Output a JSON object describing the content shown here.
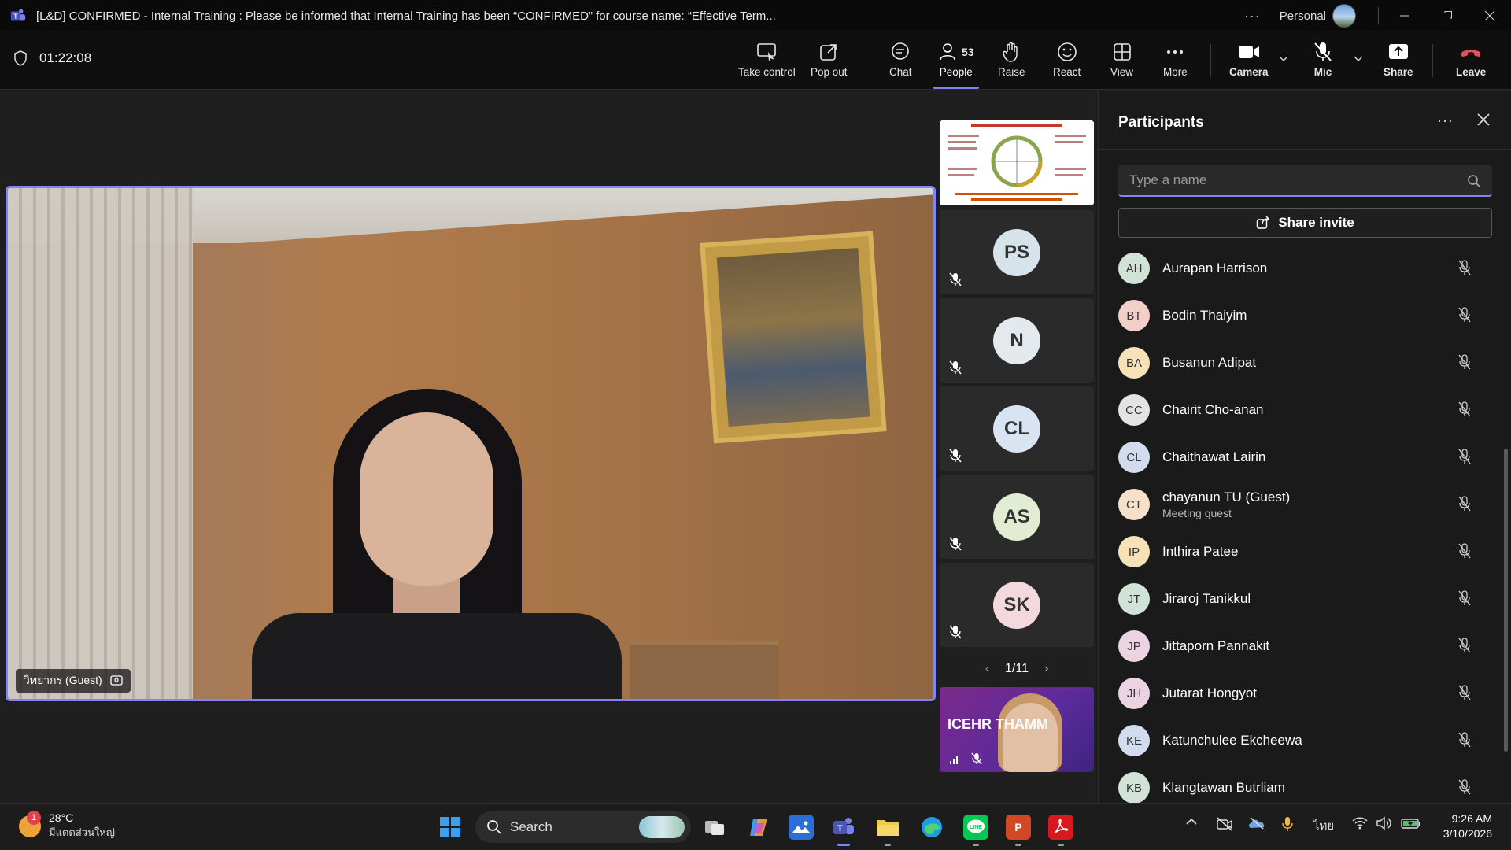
{
  "window": {
    "title": "[L&D] CONFIRMED - Internal Training : Please be informed that Internal Training has been “CONFIRMED” for course name: “Effective Term...",
    "more": "···",
    "profile": "Personal"
  },
  "meeting": {
    "timer": "01:22:08",
    "toolbar": {
      "take_control": "Take control",
      "pop_out": "Pop out",
      "chat": "Chat",
      "people": "People",
      "people_count": "53",
      "raise": "Raise",
      "react": "React",
      "view": "View",
      "more": "More",
      "camera": "Camera",
      "mic": "Mic",
      "share": "Share",
      "leave": "Leave"
    }
  },
  "stage": {
    "speaker_name": "วิทยากร (Guest)",
    "gallery": [
      {
        "initials": "PS"
      },
      {
        "initials": "N"
      },
      {
        "initials": "CL"
      },
      {
        "initials": "AS"
      },
      {
        "initials": "SK"
      }
    ],
    "pager": "1/11",
    "bottom_tile_text": "ICEHR THAMM"
  },
  "panel": {
    "title": "Participants",
    "search_placeholder": "Type a name",
    "share_invite": "Share invite",
    "participants": [
      {
        "initials": "AH",
        "name": "Aurapan Harrison",
        "sub": "",
        "color": "#d0e3d6"
      },
      {
        "initials": "BT",
        "name": "Bodin Thaiyim",
        "sub": "",
        "color": "#f2cfc8"
      },
      {
        "initials": "BA",
        "name": "Busanun Adipat",
        "sub": "",
        "color": "#f6e2b6"
      },
      {
        "initials": "CC",
        "name": "Chairit Cho-anan",
        "sub": "",
        "color": "#e3e3e3"
      },
      {
        "initials": "CL",
        "name": "Chaithawat Lairin",
        "sub": "",
        "color": "#d3dcef"
      },
      {
        "initials": "CT",
        "name": "chayanun TU (Guest)",
        "sub": "Meeting guest",
        "color": "#f7e0c9"
      },
      {
        "initials": "IP",
        "name": "Inthira Patee",
        "sub": "",
        "color": "#f6e2b6"
      },
      {
        "initials": "JT",
        "name": "Jiraroj Tanikkul",
        "sub": "",
        "color": "#d0e3d6"
      },
      {
        "initials": "JP",
        "name": "Jittaporn Pannakit",
        "sub": "",
        "color": "#ecd3e2"
      },
      {
        "initials": "JH",
        "name": "Jutarat Hongyot",
        "sub": "",
        "color": "#ecd3e2"
      },
      {
        "initials": "KE",
        "name": "Katunchulee Ekcheewa",
        "sub": "",
        "color": "#d3dcef"
      },
      {
        "initials": "KB",
        "name": "Klangtawan Butrliam",
        "sub": "",
        "color": "#d0e3d6"
      }
    ]
  },
  "taskbar": {
    "weather_badge": "1",
    "temperature": "28°C",
    "weather_desc": "มีแดดส่วนใหญ่",
    "search_label": "Search",
    "language": "ไทย",
    "time": "9:26 AM",
    "date": "3/10/2026"
  }
}
